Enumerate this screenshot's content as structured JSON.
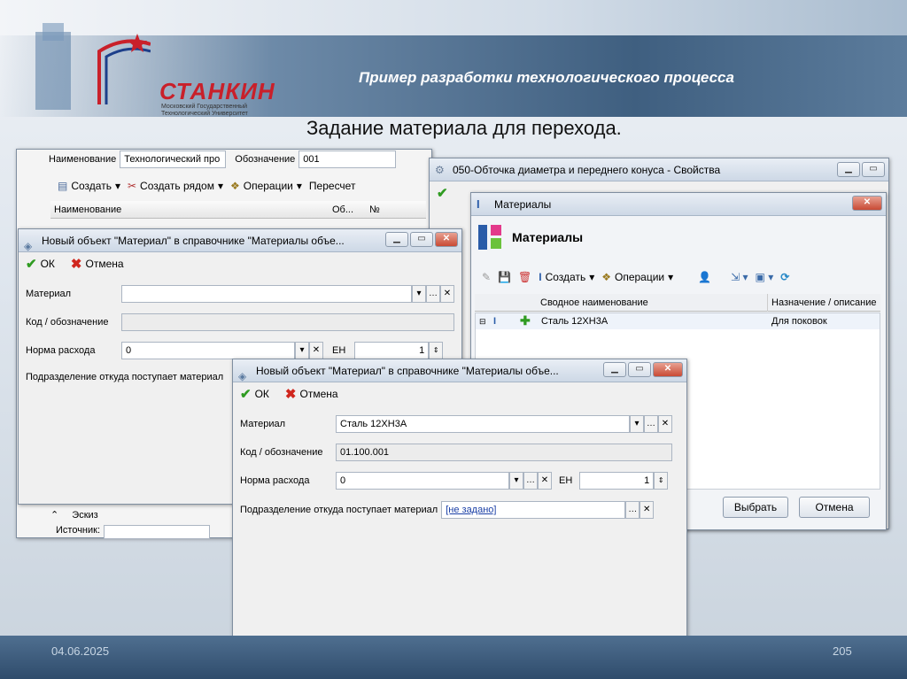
{
  "slide": {
    "title": "Пример разработки технологического процесса",
    "subtitle": "Задание материала для перехода.",
    "date": "04.06.2025",
    "page": "205",
    "logo": {
      "name": "СТАНКИН",
      "line1": "Московский Государственный",
      "line2": "Технологический Университет"
    }
  },
  "bg_window": {
    "name_label": "Наименование",
    "name_value": "Технологический про",
    "code_label": "Обозначение",
    "code_value": "001",
    "toolbar": {
      "create": "Создать",
      "create_near": "Создать рядом",
      "operations": "Операции",
      "recalc": "Пересчет"
    },
    "columns": [
      "Наименование",
      "Об...",
      "№"
    ],
    "sketch_label": "Эскиз",
    "source_label": "Источник:"
  },
  "props_window": {
    "title": "050-Обточка диаметра и переднего конуса - Свойства"
  },
  "materials_window": {
    "title": "Материалы",
    "header": "Материалы",
    "toolbar": {
      "create": "Создать",
      "operations": "Операции"
    },
    "columns": [
      "Сводное наименование",
      "Назначение / описание"
    ],
    "rows": [
      {
        "name": "Сталь 12ХН3А",
        "purpose": "Для поковок"
      }
    ],
    "select_button": "Выбрать",
    "cancel_button": "Отмена"
  },
  "dialog1": {
    "title": "Новый объект \"Материал\" в справочнике \"Материалы объе...",
    "ok": "ОК",
    "cancel": "Отмена",
    "material_label": "Материал",
    "material_value": "",
    "code_label": "Код / обозначение",
    "code_value": "",
    "norm_label": "Норма расхода",
    "norm_value": "0",
    "unit_label": "ЕН",
    "unit_value": "1",
    "dept_label": "Подразделение откуда поступает материал"
  },
  "dialog2": {
    "title": "Новый объект \"Материал\" в справочнике \"Материалы объе...",
    "ok": "ОК",
    "cancel": "Отмена",
    "material_label": "Материал",
    "material_value": "Сталь 12ХН3А",
    "code_label": "Код / обозначение",
    "code_value": "01.100.001",
    "norm_label": "Норма расхода",
    "norm_value": "0",
    "unit_label": "ЕН",
    "unit_value": "1",
    "dept_label": "Подразделение откуда поступает материал",
    "dept_value": "[не задано]"
  },
  "icons": [
    "check-icon",
    "cross-icon",
    "window-icon",
    "materials-icon",
    "save-icon",
    "plus-icon",
    "refresh-icon"
  ],
  "colors": {
    "accent_red": "#c9202a",
    "ok_green": "#2f9b21",
    "title_blue": "#3f5f80"
  }
}
